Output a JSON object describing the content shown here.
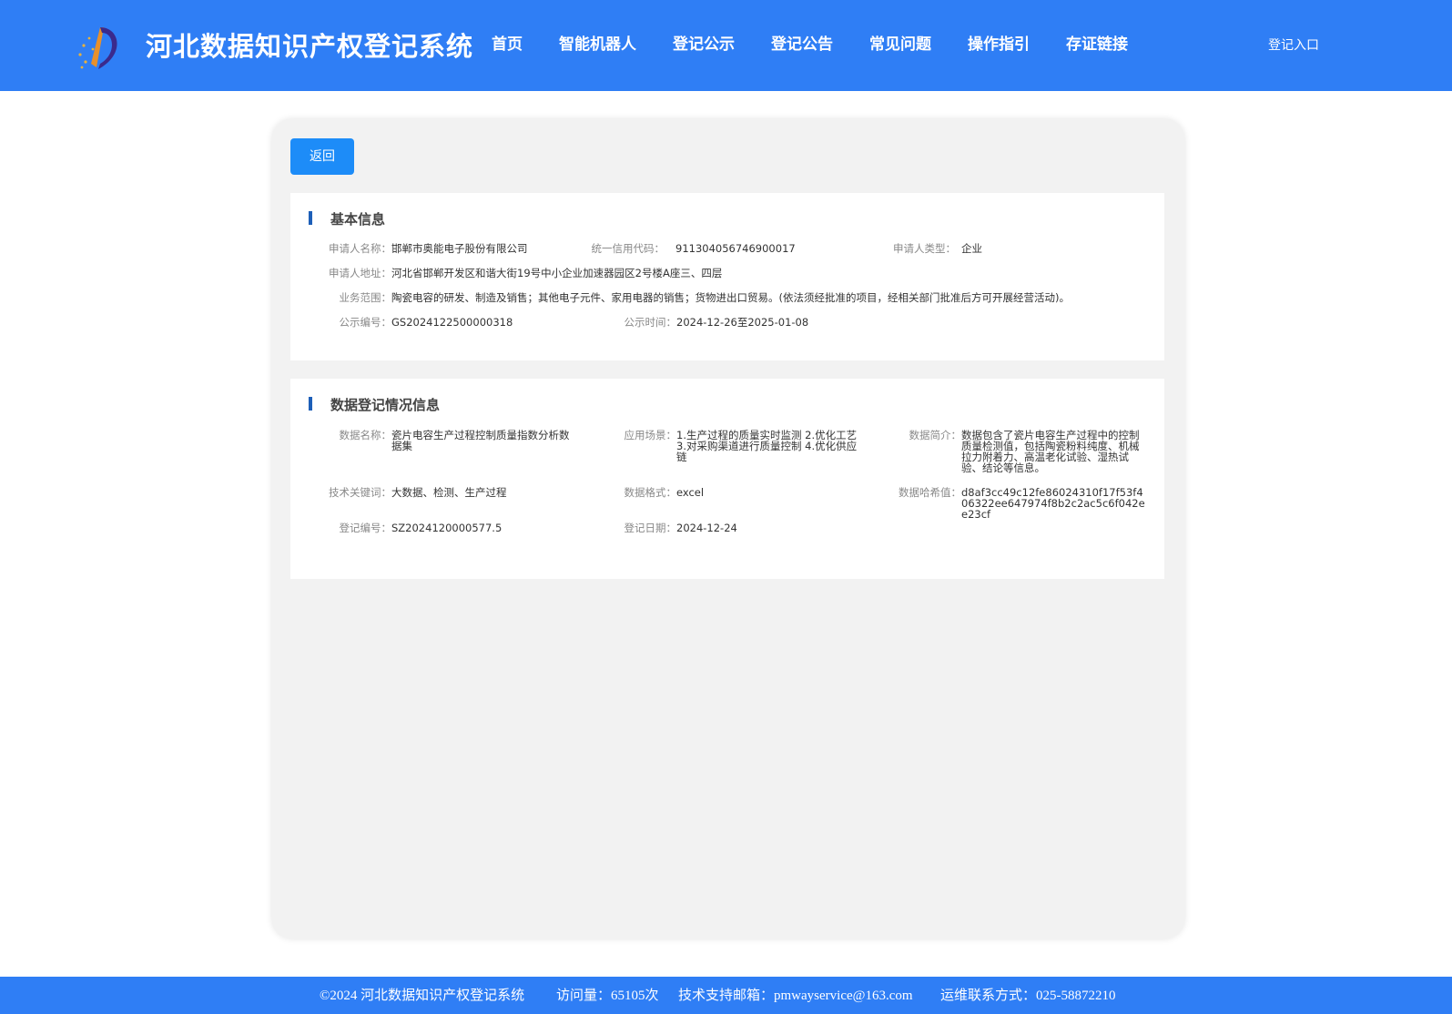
{
  "header": {
    "title": "河北数据知识产权登记系统",
    "nav": [
      "首页",
      "智能机器人",
      "登记公示",
      "登记公告",
      "常见问题",
      "操作指引",
      "存证链接"
    ],
    "login_label": "登记入口"
  },
  "back_label": "返回",
  "basic_info": {
    "title": "基本信息",
    "applicant_name": {
      "label": "申请人名称：",
      "value": "邯郸市奥能电子股份有限公司"
    },
    "credit_code": {
      "label": "统一信用代码：",
      "value": "911304056746900017"
    },
    "applicant_type": {
      "label": "申请人类型：",
      "value": "企业"
    },
    "address": {
      "label": "申请人地址：",
      "value": "河北省邯郸开发区和谐大街19号中小企业加速器园区2号楼A座三、四层"
    },
    "business_scope": {
      "label": "业务范围：",
      "value": "陶瓷电容的研发、制造及销售；其他电子元件、家用电器的销售；货物进出口贸易。(依法须经批准的项目，经相关部门批准后方可开展经营活动)。"
    },
    "notice_no": {
      "label": "公示编号：",
      "value": "GS2024122500000318"
    },
    "notice_time": {
      "label": "公示时间：",
      "value": "2024-12-26至2025-01-08"
    }
  },
  "data_info": {
    "title": "数据登记情况信息",
    "data_name": {
      "label": "数据名称：",
      "value": "瓷片电容生产过程控制质量指数分析数据集"
    },
    "scenario": {
      "label": "应用场景：",
      "value": "1.生产过程的质量实时监测 2.优化工艺 3.对采购渠道进行质量控制 4.优化供应链"
    },
    "summary": {
      "label": "数据简介：",
      "value": "数据包含了瓷片电容生产过程中的控制质量检测值，包括陶瓷粉料纯度、机械拉力附着力、高温老化试验、湿热试验、结论等信息。"
    },
    "keywords": {
      "label": "技术关键词：",
      "value": "大数据、检测、生产过程"
    },
    "format": {
      "label": "数据格式：",
      "value": "excel"
    },
    "hash": {
      "label": "数据哈希值：",
      "value": "d8af3cc49c12fe86024310f17f53f406322ee647974f8b2c2ac5c6f042ee23cf"
    },
    "reg_no": {
      "label": "登记编号：",
      "value": "SZ2024120000577.5"
    },
    "reg_date": {
      "label": "登记日期：",
      "value": "2024-12-24"
    }
  },
  "footer": {
    "copyright": "©2024 河北数据知识产权登记系统",
    "visits": "访问量：65105次",
    "email": "技术支持邮箱：pmwayservice@163.com",
    "contact": "运维联系方式：025-58872210"
  },
  "colors": {
    "header_bg": "#2f7ef5",
    "button": "#1d8cf8",
    "section_bar": "#1d5fb8"
  }
}
